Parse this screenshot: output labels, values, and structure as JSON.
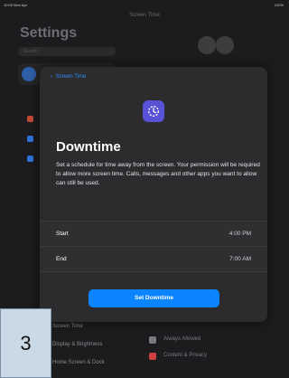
{
  "status_bar": {
    "left": "10:00 Mon Apr",
    "right": "100%"
  },
  "background": {
    "top_title": "Screen Time",
    "settings_title": "Settings",
    "search_placeholder": "Search",
    "left_list": [
      {
        "label": "Screen Time"
      },
      {
        "label": "Display & Brightness"
      },
      {
        "label": "Home Screen & Dock"
      }
    ],
    "right_list": [
      {
        "label": "Always Allowed"
      },
      {
        "label": "Content & Privacy"
      }
    ]
  },
  "modal": {
    "back_label": "Screen Time",
    "title": "Downtime",
    "description": "Set a schedule for time away from the screen. Your permission will be required to allow more screen time. Calls, messages and other apps you want to allow can still be used.",
    "rows": [
      {
        "label": "Start",
        "value": "4:00 PM"
      },
      {
        "label": "End",
        "value": "7:00 AM"
      }
    ],
    "cta_label": "Set Downtime"
  },
  "page_badge": "3",
  "colors": {
    "accent": "#0a84ff",
    "app_icon": "#5852d6"
  },
  "icons": {
    "back": "chevron-left-icon",
    "downtime": "downtime-icon"
  }
}
